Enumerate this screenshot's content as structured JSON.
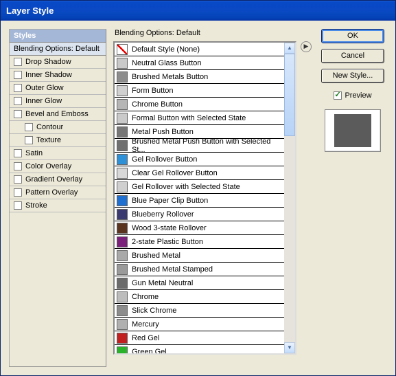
{
  "window": {
    "title": "Layer Style"
  },
  "left": {
    "header": "Styles",
    "sub": "Blending Options: Default",
    "items": [
      {
        "label": "Drop Shadow",
        "indent": false
      },
      {
        "label": "Inner Shadow",
        "indent": false
      },
      {
        "label": "Outer Glow",
        "indent": false
      },
      {
        "label": "Inner Glow",
        "indent": false
      },
      {
        "label": "Bevel and Emboss",
        "indent": false
      },
      {
        "label": "Contour",
        "indent": true
      },
      {
        "label": "Texture",
        "indent": true
      },
      {
        "label": "Satin",
        "indent": false
      },
      {
        "label": "Color Overlay",
        "indent": false
      },
      {
        "label": "Gradient Overlay",
        "indent": false
      },
      {
        "label": "Pattern Overlay",
        "indent": false
      },
      {
        "label": "Stroke",
        "indent": false
      }
    ]
  },
  "center": {
    "title": "Blending Options: Default",
    "styles": [
      {
        "label": "Default Style (None)",
        "swatch": "none"
      },
      {
        "label": "Neutral Glass Button",
        "swatch": "#c9c9c9"
      },
      {
        "label": "Brushed Metals Button",
        "swatch": "#8d8d8d"
      },
      {
        "label": "Form Button",
        "swatch": "#d0d0d0"
      },
      {
        "label": "Chrome Button",
        "swatch": "#b5b5b5"
      },
      {
        "label": "Formal Button with Selected State",
        "swatch": "#cacaca"
      },
      {
        "label": "Metal Push Button",
        "swatch": "#777777"
      },
      {
        "label": "Brushed Metal Push Button with Selected St...",
        "swatch": "#6f6f6f"
      },
      {
        "label": "Gel Rollover Button",
        "swatch": "#2e90d6"
      },
      {
        "label": "Clear Gel Rollover Button",
        "swatch": "#d8d8d8"
      },
      {
        "label": "Gel Rollover with Selected State",
        "swatch": "#cfcfcf"
      },
      {
        "label": "Blue Paper Clip Button",
        "swatch": "#1f6fd0"
      },
      {
        "label": "Blueberry Rollover",
        "swatch": "#3a3a70"
      },
      {
        "label": "Wood 3-state Rollover",
        "swatch": "#5a341f"
      },
      {
        "label": "2-state Plastic Button",
        "swatch": "#7a1f7a"
      },
      {
        "label": "Brushed Metal",
        "swatch": "#a9a9a9"
      },
      {
        "label": "Brushed Metal Stamped",
        "swatch": "#9a9a9a"
      },
      {
        "label": "Gun Metal Neutral",
        "swatch": "#6b6b6b"
      },
      {
        "label": "Chrome",
        "swatch": "#bcbcbc"
      },
      {
        "label": "Slick Chrome",
        "swatch": "#8c8c8c"
      },
      {
        "label": "Mercury",
        "swatch": "#b0b0b0"
      },
      {
        "label": "Red Gel",
        "swatch": "#c22020"
      },
      {
        "label": "Green Gel",
        "swatch": "#2bb22b"
      }
    ]
  },
  "right": {
    "ok": "OK",
    "cancel": "Cancel",
    "newstyle": "New Style...",
    "preview": "Preview"
  }
}
